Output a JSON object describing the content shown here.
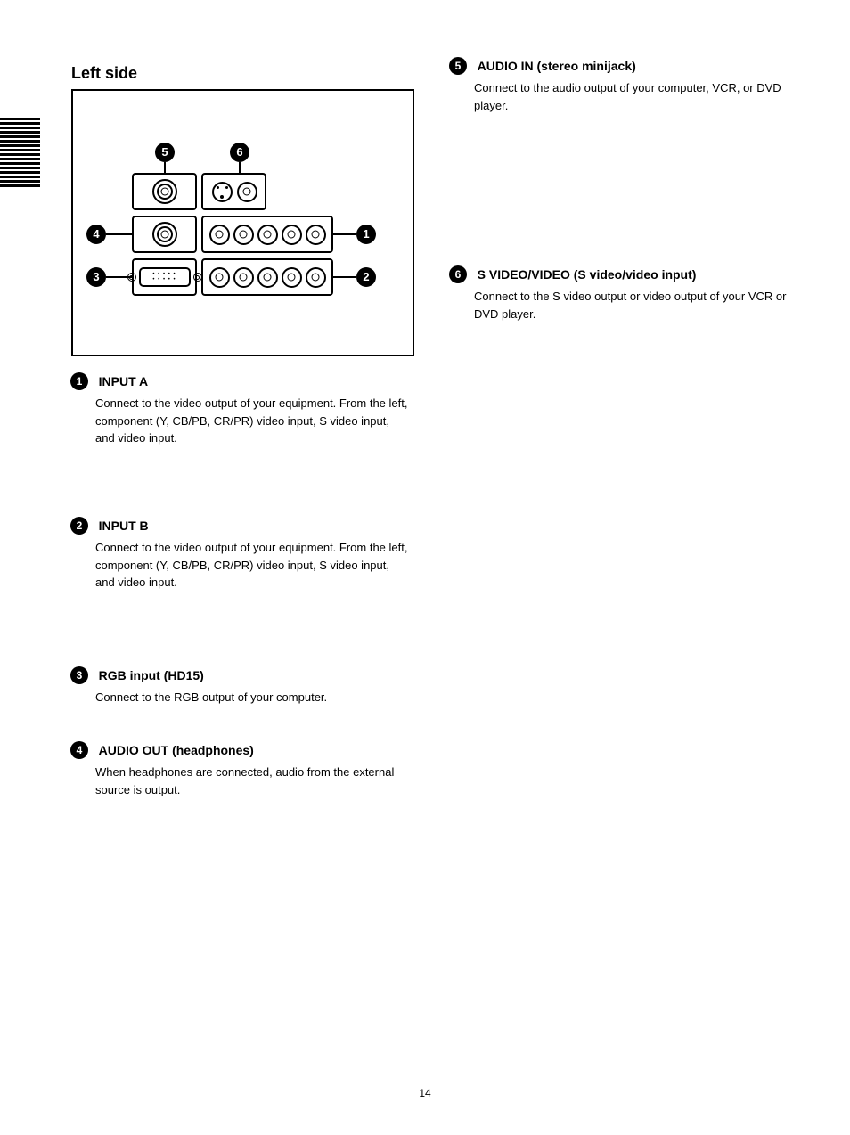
{
  "section_title": "Left side",
  "page_number": "14",
  "callouts": {
    "c1": "1",
    "c2": "2",
    "c3": "3",
    "c4": "4",
    "c5": "5",
    "c6": "6"
  },
  "items": [
    {
      "num": "1",
      "heading": "INPUT A",
      "body": "Connect to the video output of your equipment. From the left, component (Y, CB/PB, CR/PR) video input, S video input, and video input."
    },
    {
      "num": "2",
      "heading": "INPUT B",
      "body": "Connect to the video output of your equipment. From the left, component (Y, CB/PB, CR/PR) video input, S video input, and video input."
    },
    {
      "num": "3",
      "heading": "RGB input (HD15)",
      "body": "Connect to the RGB output of your computer."
    },
    {
      "num": "4",
      "heading": "AUDIO OUT (headphones)",
      "body": "When headphones are connected, audio from the external source is output."
    },
    {
      "num": "5",
      "heading": "AUDIO IN (stereo minijack)",
      "body": "Connect to the audio output of your computer, VCR, or DVD player."
    },
    {
      "num": "6",
      "heading": "S VIDEO/VIDEO (S video/video input)",
      "body": "Connect to the S video output or video output of your VCR or DVD player."
    }
  ]
}
